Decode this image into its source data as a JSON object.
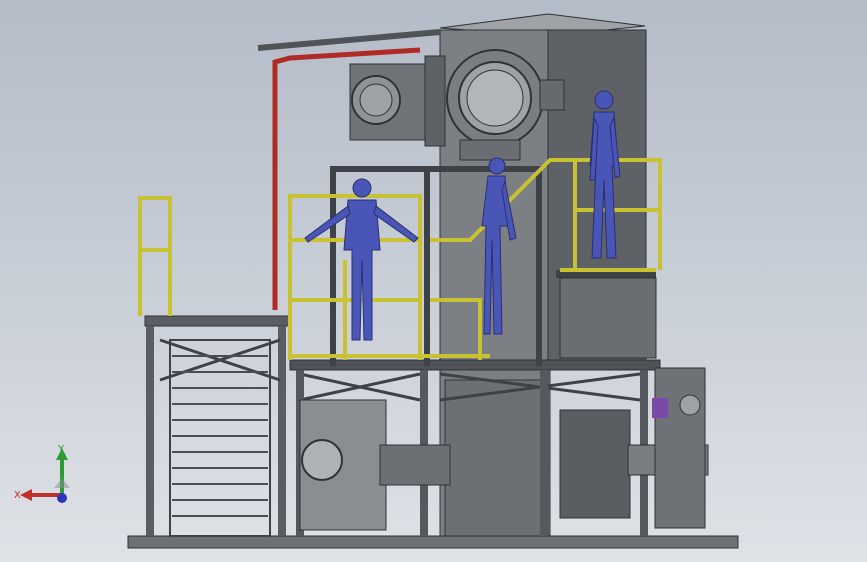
{
  "viewport": {
    "background_top": "#b4bcc8",
    "background_bottom": "#dfe2e7"
  },
  "colors": {
    "steel": "#75787c",
    "steel_dark": "#3e4145",
    "railing_yellow": "#c8c232",
    "pipe_red": "#b02a26",
    "human_blue": "#4a55b8",
    "accent_purple": "#7a4aa8"
  },
  "figures": [
    {
      "name": "figure-left-platform"
    },
    {
      "name": "figure-middle-stair"
    },
    {
      "name": "figure-right-top"
    }
  ],
  "triad": {
    "x_label": "X",
    "y_label": "Y",
    "x_color": "#c0302a",
    "y_color": "#2e9a35",
    "z_color": "#2a35b8"
  }
}
